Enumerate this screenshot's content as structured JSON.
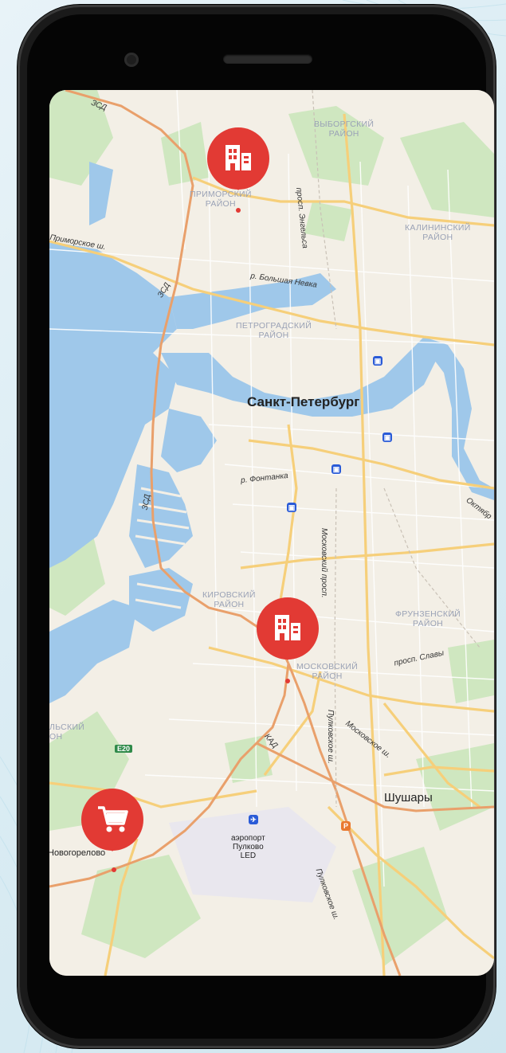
{
  "map": {
    "city": "Санкт-Петербург",
    "districts": {
      "primorsky": [
        "ПРИМОРСКИЙ",
        "РАЙОН"
      ],
      "vyborgsky": [
        "ВЫБОРГСКИЙ",
        "РАЙОН"
      ],
      "kalininsky": [
        "КАЛИНИНСКИЙ",
        "РАЙОН"
      ],
      "petrogradsky": [
        "ПЕТРОГРАДСКИЙ",
        "РАЙОН"
      ],
      "kirovsky": [
        "КИРОВСКИЙ",
        "РАЙОН"
      ],
      "moskovsky": [
        "МОСКОВСКИЙ",
        "РАЙОН"
      ],
      "frunzensky": [
        "ФРУНЗЕНСКИЙ",
        "РАЙОН"
      ],
      "partial_left": [
        "ЛЬСКИЙ",
        "ОН"
      ]
    },
    "roads": {
      "zsd_top": "ЗСД",
      "zsd_mid": "ЗСД",
      "zsd_low": "ЗСД",
      "primorskoe": "Приморское ш.",
      "engelsa": "просп. Энгельса",
      "bolshaya_nevka": "р. Большая Невка",
      "fontanka": "р. Фонтанка",
      "moskovsky_prosp": "Московский просп.",
      "oktyabr": "Октябр",
      "slavy": "просп. Славы",
      "kad": "КАД",
      "moskovskoe_sh": "Московское ш.",
      "pulkovskoe_1": "Пулковское ш.",
      "pulkovskoe_2": "Пулковское ш.",
      "e20": "E20"
    },
    "places": {
      "shushary": "Шушары",
      "novogorelovo": "Новогорелово",
      "airport_line1": "аэропорт",
      "airport_line2": "Пулково",
      "airport_line3": "LED"
    },
    "markers": [
      {
        "type": "office",
        "icon": "building-icon",
        "color": "#e23a34"
      },
      {
        "type": "office",
        "icon": "building-icon",
        "color": "#e23a34"
      },
      {
        "type": "shop",
        "icon": "shopping-cart-icon",
        "color": "#e23a34"
      }
    ],
    "colors": {
      "water": "#9fc8ea",
      "land": "#f3efe6",
      "park": "#cfe7c0",
      "road_major": "#f6cf7a",
      "highway": "#e9a06b",
      "marker": "#e23a34"
    }
  }
}
